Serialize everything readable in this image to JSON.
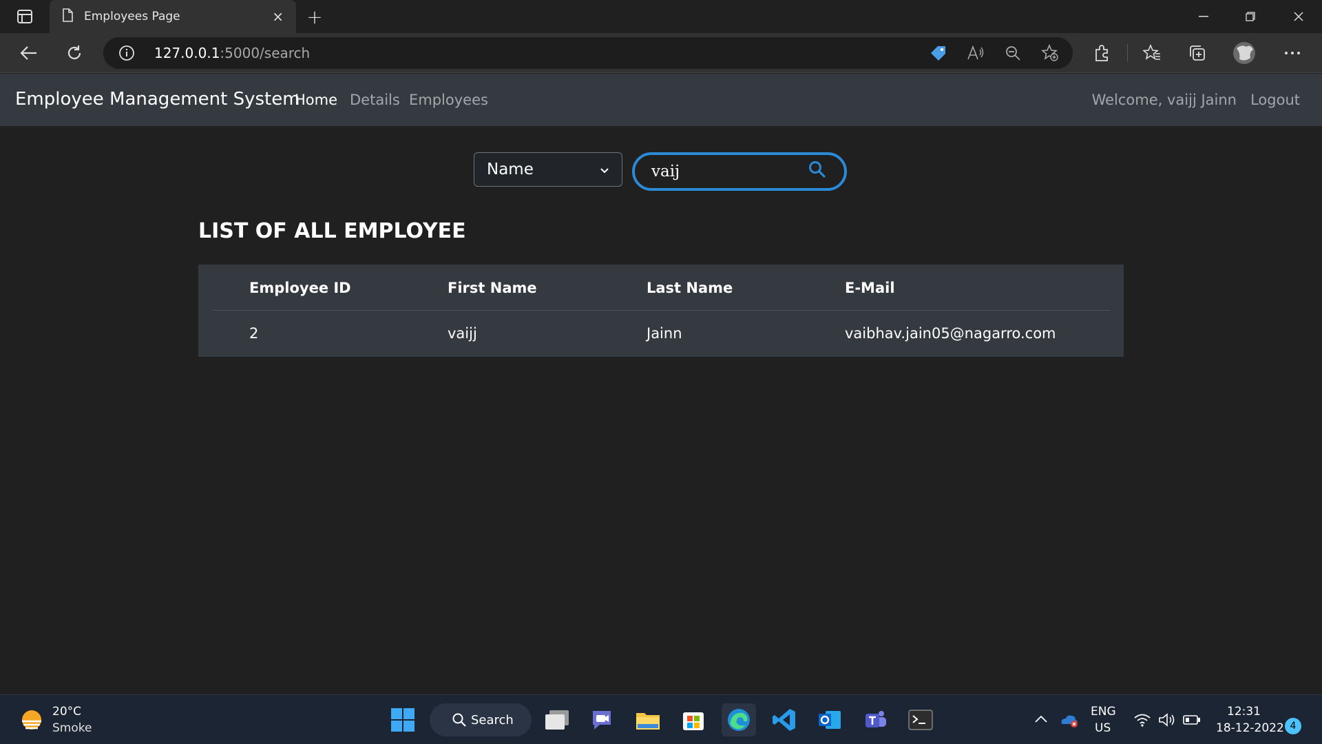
{
  "browser": {
    "tab_title": "Employees Page",
    "url_host": "127.0.0.1",
    "url_path": ":5000/search",
    "new_tab": "+",
    "close_tab": "×"
  },
  "app": {
    "brand": "Employee Management System",
    "nav": [
      "Home",
      "Details",
      "Employees"
    ],
    "welcome": "Welcome, vaijj Jainn",
    "logout": "Logout"
  },
  "search": {
    "field_selected": "Name",
    "query": "vaij"
  },
  "heading": "LIST OF ALL EMPLOYEE",
  "table": {
    "headers": [
      "Employee ID",
      "First Name",
      "Last Name",
      "E-Mail"
    ],
    "rows": [
      [
        "2",
        "vaijj",
        "Jainn",
        "vaibhav.jain05@nagarro.com"
      ]
    ]
  },
  "taskbar": {
    "weather_temp": "20°C",
    "weather_cond": "Smoke",
    "search_label": "Search",
    "lang_1": "ENG",
    "lang_2": "US",
    "time": "12:31",
    "date": "18-12-2022",
    "notification_count": "4"
  },
  "colors": {
    "accent": "#2b8ad8",
    "navbar": "#343a40",
    "page_bg": "#202020"
  }
}
